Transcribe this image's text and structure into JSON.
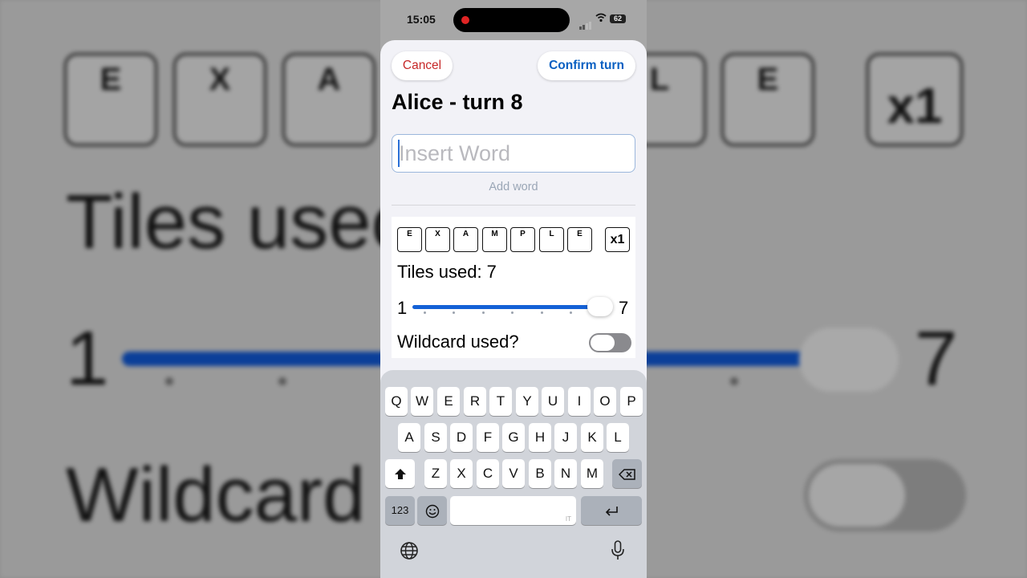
{
  "status": {
    "time": "15:05",
    "battery": "62"
  },
  "header": {
    "cancel_label": "Cancel",
    "confirm_label": "Confirm turn",
    "title": "Alice - turn 8"
  },
  "word_input": {
    "value": "",
    "placeholder": "Insert Word",
    "add_label": "Add word"
  },
  "word_tiles": [
    "E",
    "X",
    "A",
    "M",
    "P",
    "L",
    "E"
  ],
  "multiplier": "x1",
  "tiles_used_label": "Tiles used: 7",
  "slider": {
    "min": "1",
    "max": "7",
    "value": 7
  },
  "wildcard": {
    "label": "Wildcard used?",
    "on": false
  },
  "keyboard": {
    "row1": [
      "Q",
      "W",
      "E",
      "R",
      "T",
      "Y",
      "U",
      "I",
      "O",
      "P"
    ],
    "row2": [
      "A",
      "S",
      "D",
      "F",
      "G",
      "H",
      "J",
      "K",
      "L"
    ],
    "row3": [
      "Z",
      "X",
      "C",
      "V",
      "B",
      "N",
      "M"
    ],
    "numbers_label": "123",
    "space_hint": "IT"
  },
  "background": {
    "tiles": [
      "E",
      "X",
      "A",
      "L",
      "E"
    ],
    "multiplier": "x1",
    "tiles_used_partial": "Tiles usec",
    "slider_min": "1",
    "slider_max": "7",
    "wildcard_partial": "Wildcard"
  },
  "colors": {
    "cancel": "#c62828",
    "confirm": "#0a60c2",
    "slider": "#1461d6"
  }
}
